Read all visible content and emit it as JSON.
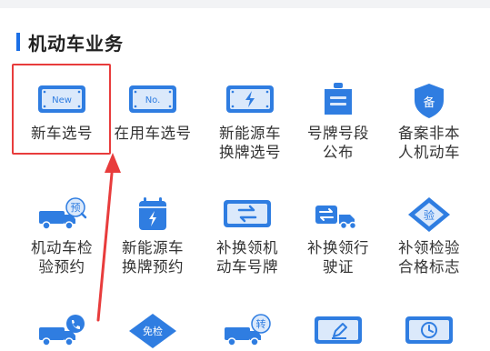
{
  "section": {
    "title": "机动车业务"
  },
  "tiles": [
    {
      "label": "新车选号",
      "icon": "new-plate-icon",
      "badge": "New"
    },
    {
      "label": "在用车选号",
      "icon": "plate-no-icon",
      "badge": "No."
    },
    {
      "label": "新能源车\n换牌选号",
      "icon": "ev-plate-icon"
    },
    {
      "label": "号牌号段\n公布",
      "icon": "plate-announce-icon"
    },
    {
      "label": "备案非本\n人机动车",
      "icon": "shield-register-icon",
      "badge": "备"
    },
    {
      "label": "机动车检\n验预约",
      "icon": "truck-inspect-icon",
      "badge": "预"
    },
    {
      "label": "新能源车\n换牌预约",
      "icon": "calendar-ev-icon"
    },
    {
      "label": "补换领机\n动车号牌",
      "icon": "plate-swap-icon"
    },
    {
      "label": "补换领行\n驶证",
      "icon": "license-swap-icon"
    },
    {
      "label": "补领检验\n合格标志",
      "icon": "diamond-inspect-icon",
      "badge": "验"
    },
    {
      "label": "",
      "icon": "truck-phone-icon"
    },
    {
      "label": "",
      "icon": "exempt-inspect-icon",
      "badge": "免检"
    },
    {
      "label": "",
      "icon": "truck-transfer-icon",
      "badge": "转"
    },
    {
      "label": "",
      "icon": "edit-card-icon"
    },
    {
      "label": "",
      "icon": "clock-card-icon"
    }
  ],
  "colors": {
    "accent": "#1b6fe6",
    "iconBlue": "#2f7de1",
    "iconLight": "#dbe9fb",
    "highlight": "#e83c3c"
  }
}
